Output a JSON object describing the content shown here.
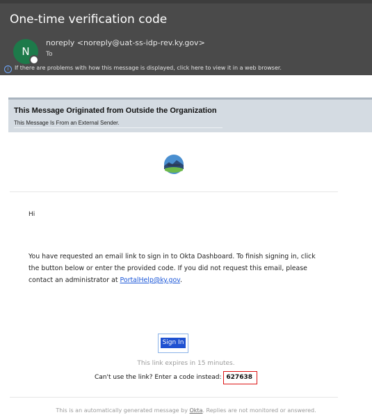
{
  "email": {
    "subject": "One-time verification code",
    "sender_initial": "N",
    "sender": "noreply <noreply@uat-ss-idp-rev.ky.gov>",
    "to_label": "To",
    "info_bar": "If there are problems with how this message is displayed, click here to view it in a web browser."
  },
  "external_banner": {
    "title": "This Message Originated from Outside the Organization",
    "subtitle": "This Message Is From an External Sender."
  },
  "body": {
    "greeting": "Hi",
    "paragraph": "You have requested an email link to sign in to Okta Dashboard. To finish signing in, click the button below or enter the provided code. If you did not request this email, please contact an administrator at",
    "support_email": "PortalHelp@ky.gov",
    "paragraph_end": ".",
    "signin_label": "Sign In",
    "expires_text": "This link expires in 15 minutes.",
    "code_prompt": "Can't use the link? Enter a code instead:",
    "code": "627638"
  },
  "footer": {
    "text_before": "This is an automatically generated message by",
    "okta_link": "Okta",
    "text_after": ". Replies are not monitored or answered."
  },
  "colors": {
    "header_bg": "#4a4a4a",
    "avatar_bg": "#1d7a4a",
    "banner_bg": "#d4dbe2",
    "signin_bg": "#1f51d1",
    "code_border": "#dd1111",
    "link": "#1a56d8"
  }
}
